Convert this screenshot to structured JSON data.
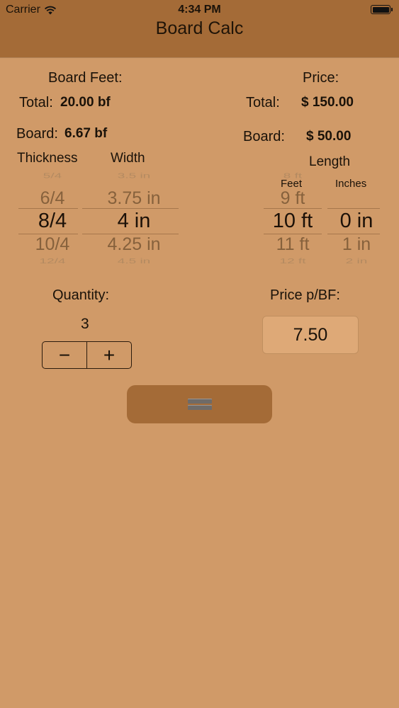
{
  "status": {
    "carrier": "Carrier",
    "time": "4:34 PM",
    "icons": [
      "wifi-icon",
      "battery-icon"
    ]
  },
  "nav": {
    "title": "Board Calc"
  },
  "board_feet": {
    "header": "Board Feet:",
    "total_label": "Total:",
    "total_value": "20.00 bf",
    "board_label": "Board:",
    "board_value": "6.67 bf"
  },
  "price": {
    "header": "Price:",
    "total_label": "Total:",
    "total_value": "$ 150.00",
    "board_label": "Board:",
    "board_value": "$ 50.00"
  },
  "pickers": {
    "thickness": {
      "label": "Thickness",
      "values": [
        "5/4",
        "6/4",
        "8/4",
        "10/4",
        "12/4"
      ]
    },
    "width": {
      "label": "Width",
      "values": [
        "3.5 in",
        "3.75 in",
        "4 in",
        "4.25 in",
        "4.5 in"
      ]
    },
    "length": {
      "label": "Length",
      "feet": {
        "label": "Feet",
        "values": [
          "8 ft",
          "9 ft",
          "10 ft",
          "11 ft",
          "12 ft"
        ]
      },
      "inches": {
        "label": "Inches",
        "values": [
          "",
          "",
          "0 in",
          "1 in",
          "2 in"
        ]
      }
    }
  },
  "quantity": {
    "label": "Quantity:",
    "value": "3",
    "minus": "−",
    "plus": "+"
  },
  "price_per_bf": {
    "label": "Price p/BF:",
    "value": "7.50"
  },
  "colors": {
    "background": "#d09a68",
    "navbar": "#a46b37",
    "button": "#a46b37",
    "input": "#dea977"
  }
}
